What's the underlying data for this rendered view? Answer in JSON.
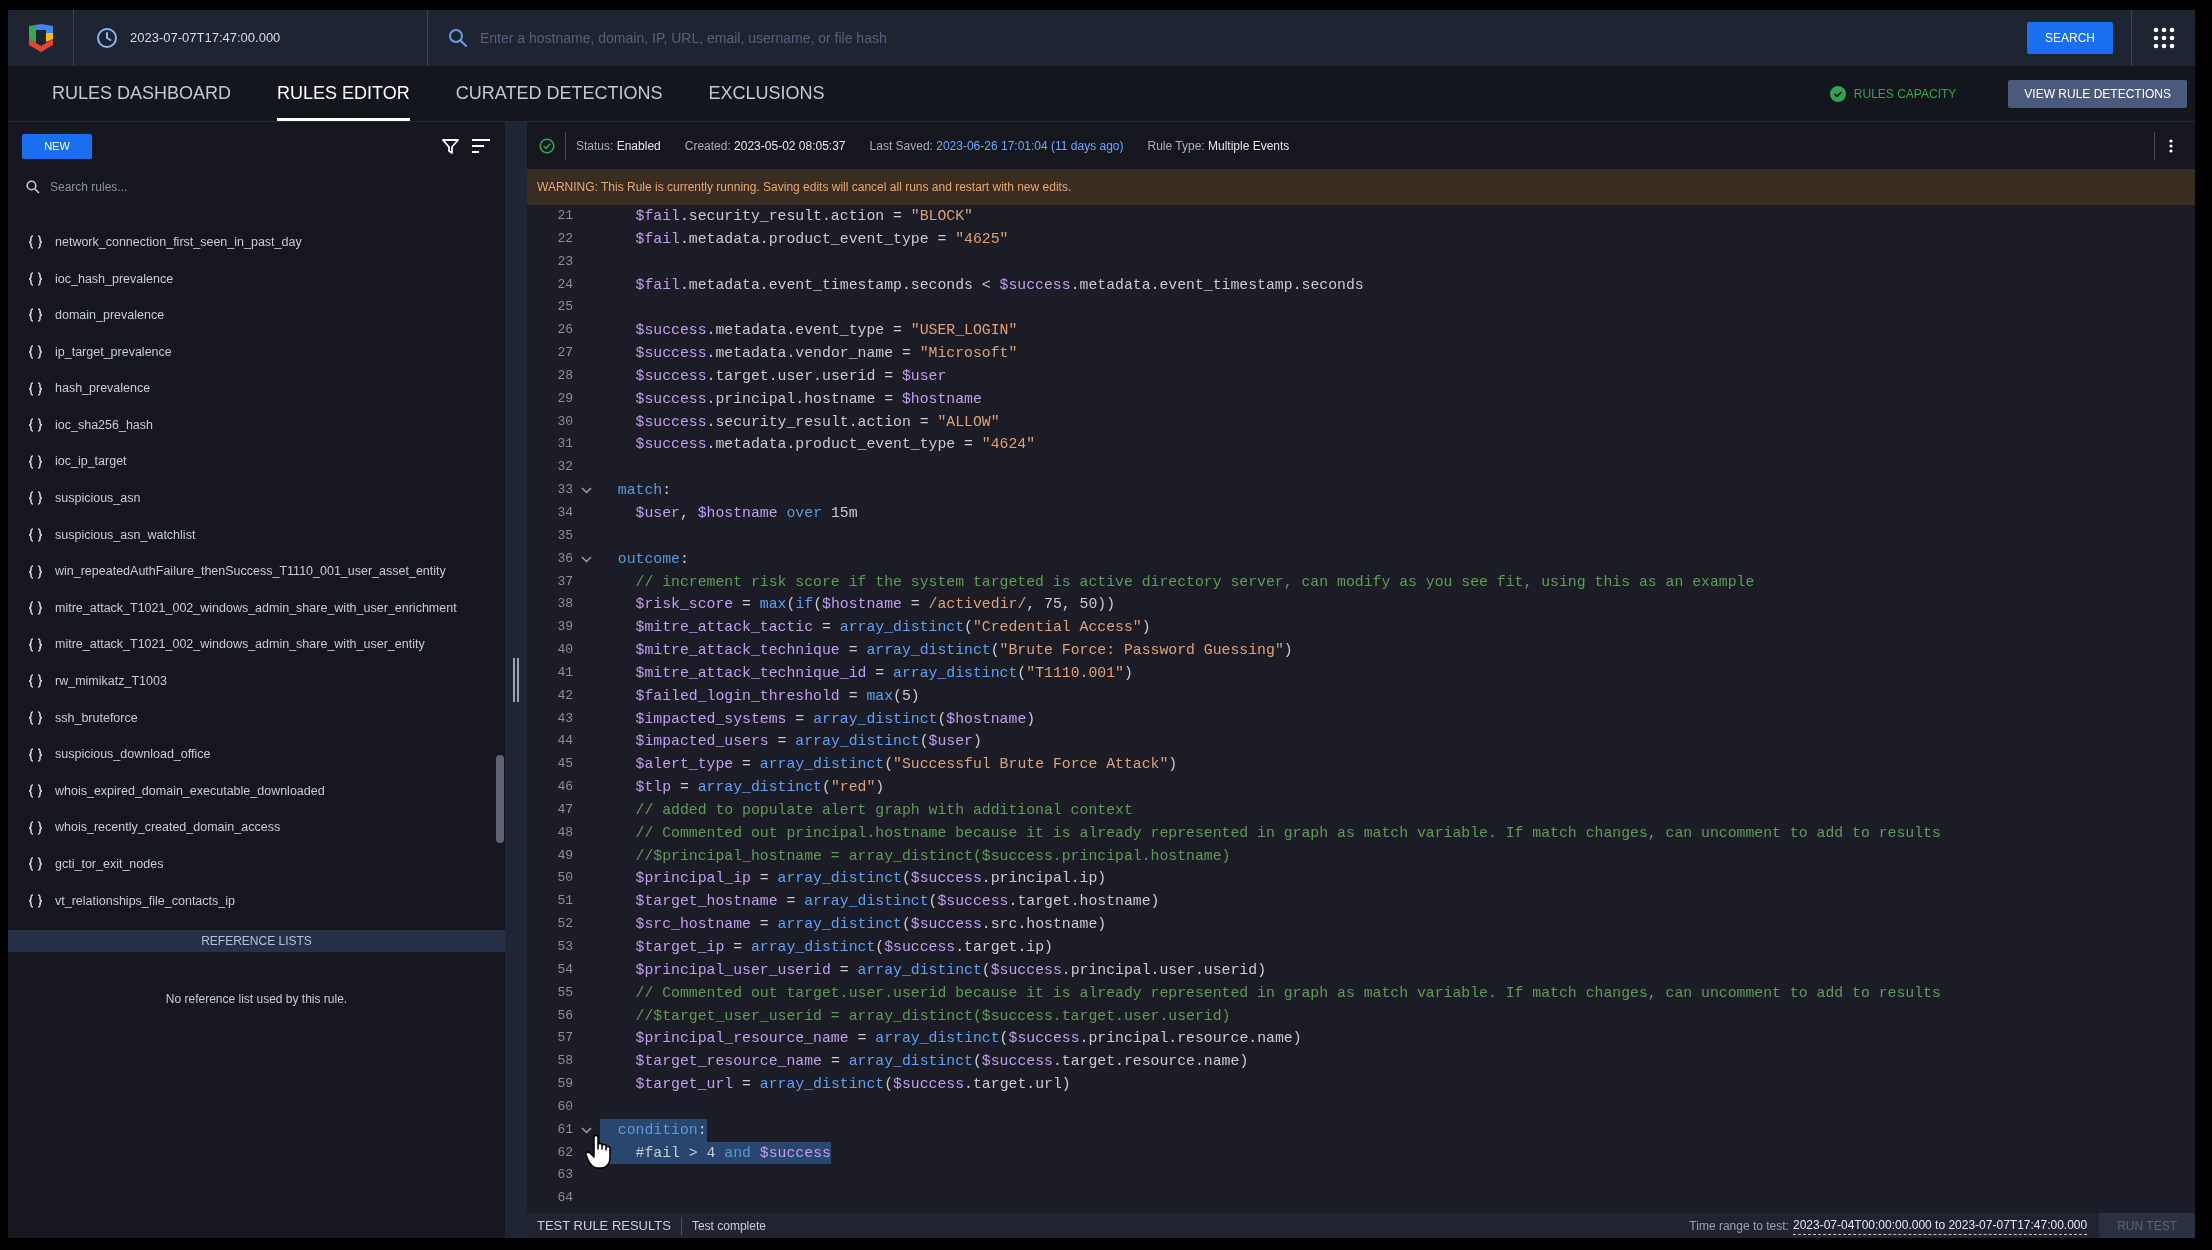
{
  "top_bar": {
    "time": "2023-07-07T17:47:00.000",
    "search": {
      "placeholder": "Enter a hostname, domain, IP, URL, email, username, or file hash"
    },
    "search_button": "SEARCH"
  },
  "tabs": [
    {
      "label": "RULES DASHBOARD",
      "selected": false
    },
    {
      "label": "RULES EDITOR",
      "selected": true
    },
    {
      "label": "CURATED DETECTIONS",
      "selected": false
    },
    {
      "label": "EXCLUSIONS",
      "selected": false
    }
  ],
  "rules_capacity": "RULES CAPACITY",
  "view_detections_button": "VIEW RULE DETECTIONS",
  "sidebar": {
    "new_button": "NEW",
    "search": {
      "placeholder": "Search rules..."
    },
    "rules": [
      "network_connection_first_seen_in_past_day",
      "ioc_hash_prevalence",
      "domain_prevalence",
      "ip_target_prevalence",
      "hash_prevalence",
      "ioc_sha256_hash",
      "ioc_ip_target",
      "suspicious_asn",
      "suspicious_asn_watchlist",
      "win_repeatedAuthFailure_thenSuccess_T1110_001_user_asset_entity",
      "mitre_attack_T1021_002_windows_admin_share_with_user_enrichment",
      "mitre_attack_T1021_002_windows_admin_share_with_user_entity",
      "rw_mimikatz_T1003",
      "ssh_bruteforce",
      "suspicious_download_office",
      "whois_expired_domain_executable_downloaded",
      "whois_recently_created_domain_access",
      "gcti_tor_exit_nodes",
      "vt_relationships_file_contacts_ip"
    ],
    "reference_lists": {
      "title": "REFERENCE LISTS",
      "empty_message": "No reference list used by this rule."
    }
  },
  "rule_status": [
    {
      "label": "Status:",
      "value": "Enabled",
      "kind": "plain"
    },
    {
      "label": "Created:",
      "value": "2023-05-02 08:05:37",
      "kind": "plain"
    },
    {
      "label": "Last Saved:",
      "value": "2023-06-26 17:01:04 (11 days ago)",
      "kind": "link"
    },
    {
      "label": "Rule Type:",
      "value": "Multiple Events",
      "kind": "plain"
    }
  ],
  "warning": "WARNING: This Rule is currently running. Saving edits will cancel all runs and restart with new edits.",
  "code_lines": [
    {
      "number": "21",
      "foldable": false,
      "selected": false,
      "tokens": [
        {
          "kind": "variable",
          "text": "    $fail"
        },
        {
          "kind": "plain",
          "text": ".security_result.action = "
        },
        {
          "kind": "string",
          "text": "\"BLOCK\""
        }
      ]
    },
    {
      "number": "22",
      "foldable": false,
      "selected": false,
      "tokens": [
        {
          "kind": "variable",
          "text": "    $fail"
        },
        {
          "kind": "plain",
          "text": ".metadata.product_event_type = "
        },
        {
          "kind": "string",
          "text": "\"4625\""
        }
      ]
    },
    {
      "number": "23",
      "foldable": false,
      "selected": false
    },
    {
      "number": "24",
      "foldable": false,
      "selected": false,
      "tokens": [
        {
          "kind": "variable",
          "text": "    $fail"
        },
        {
          "kind": "plain",
          "text": ".metadata.event_timestamp.seconds < "
        },
        {
          "kind": "variable",
          "text": "$success"
        },
        {
          "kind": "plain",
          "text": ".metadata.event_timestamp.seconds"
        }
      ]
    },
    {
      "number": "25",
      "foldable": false,
      "selected": false
    },
    {
      "number": "26",
      "foldable": false,
      "selected": false,
      "tokens": [
        {
          "kind": "variable",
          "text": "    $success"
        },
        {
          "kind": "plain",
          "text": ".metadata.event_type = "
        },
        {
          "kind": "string",
          "text": "\"USER_LOGIN\""
        }
      ]
    },
    {
      "number": "27",
      "foldable": false,
      "selected": false,
      "tokens": [
        {
          "kind": "variable",
          "text": "    $success"
        },
        {
          "kind": "plain",
          "text": ".metadata.vendor_name = "
        },
        {
          "kind": "string",
          "text": "\"Microsoft\""
        }
      ]
    },
    {
      "number": "28",
      "foldable": false,
      "selected": false,
      "tokens": [
        {
          "kind": "variable",
          "text": "    $success"
        },
        {
          "kind": "plain",
          "text": ".target.user.userid = "
        },
        {
          "kind": "variable",
          "text": "$user"
        }
      ]
    },
    {
      "number": "29",
      "foldable": false,
      "selected": false,
      "tokens": [
        {
          "kind": "variable",
          "text": "    $success"
        },
        {
          "kind": "plain",
          "text": ".principal.hostname = "
        },
        {
          "kind": "variable",
          "text": "$hostname"
        }
      ]
    },
    {
      "number": "30",
      "foldable": false,
      "selected": false,
      "tokens": [
        {
          "kind": "variable",
          "text": "    $success"
        },
        {
          "kind": "plain",
          "text": ".security_result.action = "
        },
        {
          "kind": "string",
          "text": "\"ALLOW\""
        }
      ]
    },
    {
      "number": "31",
      "foldable": false,
      "selected": false,
      "tokens": [
        {
          "kind": "variable",
          "text": "    $success"
        },
        {
          "kind": "plain",
          "text": ".metadata.product_event_type = "
        },
        {
          "kind": "string",
          "text": "\"4624\""
        }
      ]
    },
    {
      "number": "32",
      "foldable": false,
      "selected": false
    },
    {
      "number": "33",
      "foldable": true,
      "selected": false,
      "tokens": [
        {
          "kind": "keyword",
          "text": "  match"
        },
        {
          "kind": "plain",
          "text": ":"
        }
      ]
    },
    {
      "number": "34",
      "foldable": false,
      "selected": false,
      "tokens": [
        {
          "kind": "variable",
          "text": "    $user"
        },
        {
          "kind": "plain",
          "text": ", "
        },
        {
          "kind": "variable",
          "text": "$hostname"
        },
        {
          "kind": "keyword",
          "text": " over"
        },
        {
          "kind": "plain",
          "text": " 15m"
        }
      ]
    },
    {
      "number": "35",
      "foldable": false,
      "selected": false
    },
    {
      "number": "36",
      "foldable": true,
      "selected": false,
      "tokens": [
        {
          "kind": "keyword",
          "text": "  outcome"
        },
        {
          "kind": "plain",
          "text": ":"
        }
      ]
    },
    {
      "number": "37",
      "foldable": false,
      "selected": false,
      "tokens": [
        {
          "kind": "comment",
          "text": "    // increment risk score if the system targeted is active directory server, can modify as you see fit, using this as an example"
        }
      ]
    },
    {
      "number": "38",
      "foldable": false,
      "selected": false,
      "tokens": [
        {
          "kind": "variable",
          "text": "    $risk_score"
        },
        {
          "kind": "plain",
          "text": " = "
        },
        {
          "kind": "function",
          "text": "max"
        },
        {
          "kind": "plain",
          "text": "("
        },
        {
          "kind": "function",
          "text": "if"
        },
        {
          "kind": "plain",
          "text": "("
        },
        {
          "kind": "variable",
          "text": "$hostname"
        },
        {
          "kind": "plain",
          "text": " = "
        },
        {
          "kind": "string",
          "text": "/activedir/"
        },
        {
          "kind": "plain",
          "text": ", 75, 50))"
        }
      ]
    },
    {
      "number": "39",
      "foldable": false,
      "selected": false,
      "tokens": [
        {
          "kind": "variable",
          "text": "    $mitre_attack_tactic"
        },
        {
          "kind": "plain",
          "text": " = "
        },
        {
          "kind": "function",
          "text": "array_distinct"
        },
        {
          "kind": "plain",
          "text": "("
        },
        {
          "kind": "string",
          "text": "\"Credential Access\""
        },
        {
          "kind": "plain",
          "text": ")"
        }
      ]
    },
    {
      "number": "40",
      "foldable": false,
      "selected": false,
      "tokens": [
        {
          "kind": "variable",
          "text": "    $mitre_attack_technique"
        },
        {
          "kind": "plain",
          "text": " = "
        },
        {
          "kind": "function",
          "text": "array_distinct"
        },
        {
          "kind": "plain",
          "text": "("
        },
        {
          "kind": "string",
          "text": "\"Brute Force: Password Guessing\""
        },
        {
          "kind": "plain",
          "text": ")"
        }
      ]
    },
    {
      "number": "41",
      "foldable": false,
      "selected": false,
      "tokens": [
        {
          "kind": "variable",
          "text": "    $mitre_attack_technique_id"
        },
        {
          "kind": "plain",
          "text": " = "
        },
        {
          "kind": "function",
          "text": "array_distinct"
        },
        {
          "kind": "plain",
          "text": "("
        },
        {
          "kind": "string",
          "text": "\"T1110.001\""
        },
        {
          "kind": "plain",
          "text": ")"
        }
      ]
    },
    {
      "number": "42",
      "foldable": false,
      "selected": false,
      "tokens": [
        {
          "kind": "variable",
          "text": "    $failed_login_threshold"
        },
        {
          "kind": "plain",
          "text": " = "
        },
        {
          "kind": "function",
          "text": "max"
        },
        {
          "kind": "plain",
          "text": "(5)"
        }
      ]
    },
    {
      "number": "43",
      "foldable": false,
      "selected": false,
      "tokens": [
        {
          "kind": "variable",
          "text": "    $impacted_systems"
        },
        {
          "kind": "plain",
          "text": " = "
        },
        {
          "kind": "function",
          "text": "array_distinct"
        },
        {
          "kind": "plain",
          "text": "("
        },
        {
          "kind": "variable",
          "text": "$hostname"
        },
        {
          "kind": "plain",
          "text": ")"
        }
      ]
    },
    {
      "number": "44",
      "foldable": false,
      "selected": false,
      "tokens": [
        {
          "kind": "variable",
          "text": "    $impacted_users"
        },
        {
          "kind": "plain",
          "text": " = "
        },
        {
          "kind": "function",
          "text": "array_distinct"
        },
        {
          "kind": "plain",
          "text": "("
        },
        {
          "kind": "variable",
          "text": "$user"
        },
        {
          "kind": "plain",
          "text": ")"
        }
      ]
    },
    {
      "number": "45",
      "foldable": false,
      "selected": false,
      "tokens": [
        {
          "kind": "variable",
          "text": "    $alert_type"
        },
        {
          "kind": "plain",
          "text": " = "
        },
        {
          "kind": "function",
          "text": "array_distinct"
        },
        {
          "kind": "plain",
          "text": "("
        },
        {
          "kind": "string",
          "text": "\"Successful Brute Force Attack\""
        },
        {
          "kind": "plain",
          "text": ")"
        }
      ]
    },
    {
      "number": "46",
      "foldable": false,
      "selected": false,
      "tokens": [
        {
          "kind": "variable",
          "text": "    $tlp"
        },
        {
          "kind": "plain",
          "text": " = "
        },
        {
          "kind": "function",
          "text": "array_distinct"
        },
        {
          "kind": "plain",
          "text": "("
        },
        {
          "kind": "string",
          "text": "\"red\""
        },
        {
          "kind": "plain",
          "text": ")"
        }
      ]
    },
    {
      "number": "47",
      "foldable": false,
      "selected": false,
      "tokens": [
        {
          "kind": "comment",
          "text": "    // added to populate alert graph with additional context"
        }
      ]
    },
    {
      "number": "48",
      "foldable": false,
      "selected": false,
      "tokens": [
        {
          "kind": "comment",
          "text": "    // Commented out principal.hostname because it is already represented in graph as match variable. If match changes, can uncomment to add to results"
        }
      ]
    },
    {
      "number": "49",
      "foldable": false,
      "selected": false,
      "tokens": [
        {
          "kind": "comment",
          "text": "    //$principal_hostname = array_distinct($success.principal.hostname)"
        }
      ]
    },
    {
      "number": "50",
      "foldable": false,
      "selected": false,
      "tokens": [
        {
          "kind": "variable",
          "text": "    $principal_ip"
        },
        {
          "kind": "plain",
          "text": " = "
        },
        {
          "kind": "function",
          "text": "array_distinct"
        },
        {
          "kind": "plain",
          "text": "("
        },
        {
          "kind": "variable",
          "text": "$success"
        },
        {
          "kind": "plain",
          "text": ".principal.ip)"
        }
      ]
    },
    {
      "number": "51",
      "foldable": false,
      "selected": false,
      "tokens": [
        {
          "kind": "variable",
          "text": "    $target_hostname"
        },
        {
          "kind": "plain",
          "text": " = "
        },
        {
          "kind": "function",
          "text": "array_distinct"
        },
        {
          "kind": "plain",
          "text": "("
        },
        {
          "kind": "variable",
          "text": "$success"
        },
        {
          "kind": "plain",
          "text": ".target.hostname)"
        }
      ]
    },
    {
      "number": "52",
      "foldable": false,
      "selected": false,
      "tokens": [
        {
          "kind": "variable",
          "text": "    $src_hostname"
        },
        {
          "kind": "plain",
          "text": " = "
        },
        {
          "kind": "function",
          "text": "array_distinct"
        },
        {
          "kind": "plain",
          "text": "("
        },
        {
          "kind": "variable",
          "text": "$success"
        },
        {
          "kind": "plain",
          "text": ".src.hostname)"
        }
      ]
    },
    {
      "number": "53",
      "foldable": false,
      "selected": false,
      "tokens": [
        {
          "kind": "variable",
          "text": "    $target_ip"
        },
        {
          "kind": "plain",
          "text": " = "
        },
        {
          "kind": "function",
          "text": "array_distinct"
        },
        {
          "kind": "plain",
          "text": "("
        },
        {
          "kind": "variable",
          "text": "$success"
        },
        {
          "kind": "plain",
          "text": ".target.ip)"
        }
      ]
    },
    {
      "number": "54",
      "foldable": false,
      "selected": false,
      "tokens": [
        {
          "kind": "variable",
          "text": "    $principal_user_userid"
        },
        {
          "kind": "plain",
          "text": " = "
        },
        {
          "kind": "function",
          "text": "array_distinct"
        },
        {
          "kind": "plain",
          "text": "("
        },
        {
          "kind": "variable",
          "text": "$success"
        },
        {
          "kind": "plain",
          "text": ".principal.user.userid)"
        }
      ]
    },
    {
      "number": "55",
      "foldable": false,
      "selected": false,
      "tokens": [
        {
          "kind": "comment",
          "text": "    // Commented out target.user.userid because it is already represented in graph as match variable. If match changes, can uncomment to add to results"
        }
      ]
    },
    {
      "number": "56",
      "foldable": false,
      "selected": false,
      "tokens": [
        {
          "kind": "comment",
          "text": "    //$target_user_userid = array_distinct($success.target.user.userid)"
        }
      ]
    },
    {
      "number": "57",
      "foldable": false,
      "selected": false,
      "tokens": [
        {
          "kind": "variable",
          "text": "    $principal_resource_name"
        },
        {
          "kind": "plain",
          "text": " = "
        },
        {
          "kind": "function",
          "text": "array_distinct"
        },
        {
          "kind": "plain",
          "text": "("
        },
        {
          "kind": "variable",
          "text": "$success"
        },
        {
          "kind": "plain",
          "text": ".principal.resource.name)"
        }
      ]
    },
    {
      "number": "58",
      "foldable": false,
      "selected": false,
      "tokens": [
        {
          "kind": "variable",
          "text": "    $target_resource_name"
        },
        {
          "kind": "plain",
          "text": " = "
        },
        {
          "kind": "function",
          "text": "array_distinct"
        },
        {
          "kind": "plain",
          "text": "("
        },
        {
          "kind": "variable",
          "text": "$success"
        },
        {
          "kind": "plain",
          "text": ".target.resource.name)"
        }
      ]
    },
    {
      "number": "59",
      "foldable": false,
      "selected": false,
      "tokens": [
        {
          "kind": "variable",
          "text": "    $target_url"
        },
        {
          "kind": "plain",
          "text": " = "
        },
        {
          "kind": "function",
          "text": "array_distinct"
        },
        {
          "kind": "plain",
          "text": "("
        },
        {
          "kind": "variable",
          "text": "$success"
        },
        {
          "kind": "plain",
          "text": ".target.url)"
        }
      ]
    },
    {
      "number": "60",
      "foldable": false,
      "selected": false
    },
    {
      "number": "61",
      "foldable": true,
      "selected": true,
      "tokens": [
        {
          "kind": "keyword",
          "text": "  condition"
        },
        {
          "kind": "plain",
          "text": ":"
        }
      ]
    },
    {
      "number": "62",
      "foldable": false,
      "selected": true,
      "tokens": [
        {
          "kind": "plain",
          "text": "    #fail > 4 "
        },
        {
          "kind": "keyword",
          "text": "and"
        },
        {
          "kind": "variable",
          "text": " $success"
        }
      ]
    },
    {
      "number": "63",
      "foldable": false,
      "selected": false
    },
    {
      "number": "64",
      "foldable": false,
      "selected": false
    }
  ],
  "test_bar": {
    "title": "TEST RULE RESULTS",
    "status": "Test complete",
    "range_label": "Time range to test:",
    "range_value": "2023-07-04T00:00:00.000 to 2023-07-07T17:47:00.000",
    "run_button": {
      "label": "RUN TEST",
      "disabled": true
    }
  }
}
